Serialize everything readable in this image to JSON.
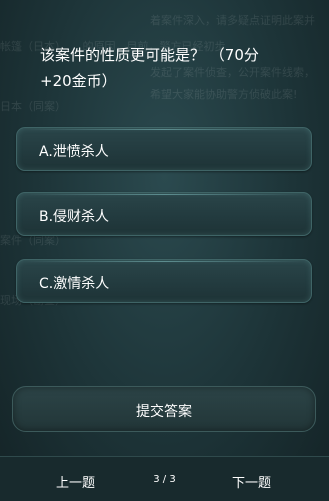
{
  "question": {
    "line1": "该案件的性质更可能是？ （70分",
    "line2": "+20金币）"
  },
  "options": [
    {
      "label": "A.泄愤杀人"
    },
    {
      "label": "B.侵财杀人"
    },
    {
      "label": "C.激情杀人"
    }
  ],
  "submit_label": "提交答案",
  "nav": {
    "prev_label": "上一题",
    "page_indicator": "3 / 3",
    "next_label": "下一题"
  }
}
